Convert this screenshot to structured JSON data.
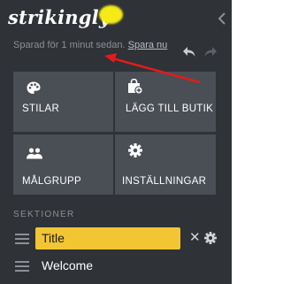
{
  "app": {
    "logo_text": "strikingly"
  },
  "status": {
    "saved_text": "Sparad för 1 minut sedan.",
    "save_now_label": "Spara nu"
  },
  "tiles": [
    {
      "icon": "palette-icon",
      "label": "STILAR"
    },
    {
      "icon": "shopping-bag-icon",
      "label": "LÄGG TILL BUTIK"
    },
    {
      "icon": "people-icon",
      "label": "MÅLGRUPP"
    },
    {
      "icon": "settings-icon",
      "label": "INSTÄLLNINGAR"
    }
  ],
  "sections": {
    "heading": "SEKTIONER",
    "items": [
      {
        "name": "Title",
        "editing": true
      },
      {
        "name": "Welcome",
        "editing": false
      }
    ]
  },
  "colors": {
    "panel_bg": "#2f3236",
    "tile_bg": "#4a4e55",
    "accent_yellow": "#f2c533",
    "annotation_red": "#e31b1b",
    "highlight": "#f5ea16"
  },
  "icons": [
    "chevron-left-icon",
    "undo-icon",
    "redo-icon",
    "drag-handle-icon",
    "close-icon",
    "gear-icon"
  ]
}
